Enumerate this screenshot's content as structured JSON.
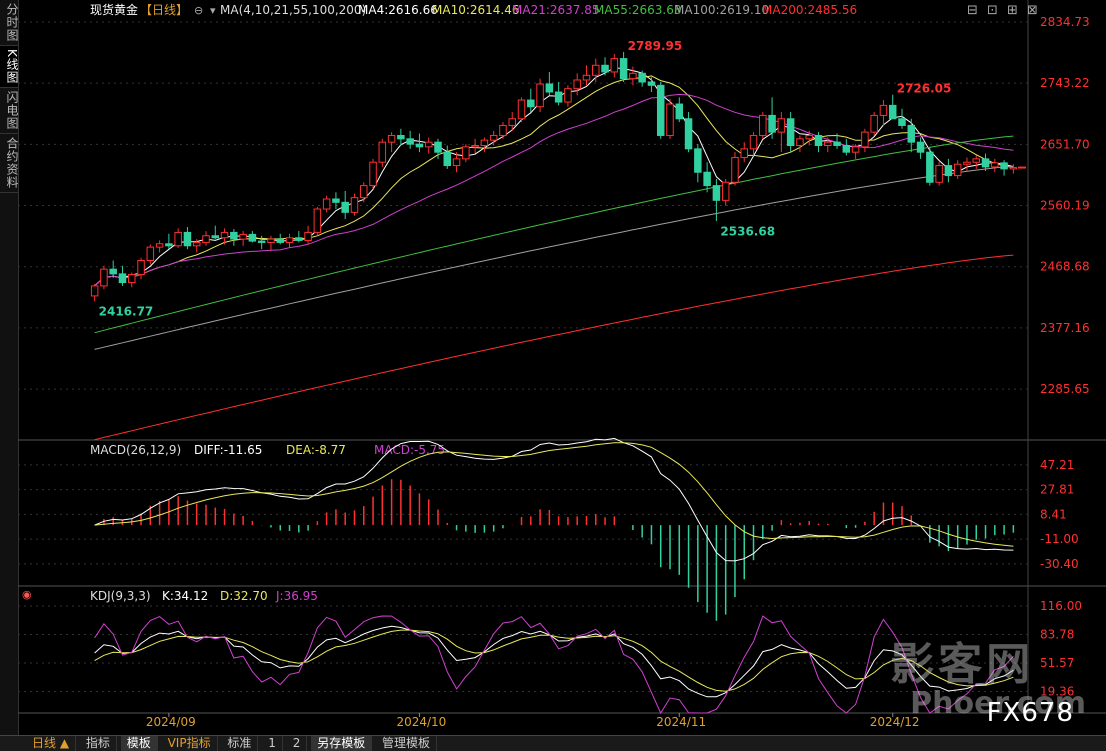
{
  "sidebar": {
    "tabs": [
      {
        "label": "分时图",
        "active": false
      },
      {
        "label": "K线图",
        "active": true
      },
      {
        "label": "闪电图",
        "active": false
      },
      {
        "label": "合约资料",
        "active": false
      }
    ]
  },
  "header": {
    "symbol": "现货黄金",
    "period_tag": "【日线】",
    "ma_label": "MA(4,10,21,55,100,200)",
    "ma_values": [
      {
        "text": "MA4:2616.66",
        "color": "#ffffff"
      },
      {
        "text": "MA10:2614.46",
        "color": "#e8e85a"
      },
      {
        "text": "MA21:2637.85",
        "color": "#d040d0"
      },
      {
        "text": "MA55:2663.63",
        "color": "#40c040"
      },
      {
        "text": "MA100:2619.10",
        "color": "#a0a0a0"
      },
      {
        "text": "MA200:2485.56",
        "color": "#ff3030"
      }
    ]
  },
  "toolbar_icons": [
    "minimize-icon",
    "restore-icon",
    "maximize-icon",
    "close-icon"
  ],
  "colors": {
    "up": "#ff3030",
    "down": "#30d0a0",
    "axis_text": "#ff3030",
    "grid": "#333333"
  },
  "chart_data": [
    {
      "type": "candlestick",
      "ylim": [
        2209.5,
        2834.73
      ],
      "yticks": [
        "2834.73",
        "2743.22",
        "2651.70",
        "2560.19",
        "2468.68",
        "2377.16",
        "2285.65"
      ],
      "xticks": [
        "2024/09",
        "2024/10",
        "2024/11",
        "2024/12"
      ],
      "annotations": [
        {
          "text": "2789.95",
          "candle": 57,
          "value": 2789.95,
          "kind": "high"
        },
        {
          "text": "2726.05",
          "candle": 86,
          "value": 2726.05,
          "kind": "high"
        },
        {
          "text": "2536.68",
          "candle": 67,
          "value": 2536.68,
          "kind": "low"
        },
        {
          "text": "2416.77",
          "candle": 0,
          "value": 2416.77,
          "kind": "low"
        }
      ],
      "ohlc": [
        [
          2425,
          2443,
          2417,
          2440
        ],
        [
          2440,
          2470,
          2435,
          2465
        ],
        [
          2465,
          2478,
          2452,
          2458
        ],
        [
          2458,
          2470,
          2440,
          2445
        ],
        [
          2445,
          2460,
          2438,
          2457
        ],
        [
          2457,
          2482,
          2450,
          2478
        ],
        [
          2478,
          2502,
          2472,
          2498
        ],
        [
          2498,
          2508,
          2490,
          2503
        ],
        [
          2503,
          2518,
          2495,
          2500
        ],
        [
          2500,
          2526,
          2497,
          2520
        ],
        [
          2520,
          2528,
          2495,
          2500
        ],
        [
          2500,
          2510,
          2490,
          2505
        ],
        [
          2505,
          2522,
          2500,
          2515
        ],
        [
          2515,
          2530,
          2510,
          2512
        ],
        [
          2512,
          2526,
          2502,
          2520
        ],
        [
          2520,
          2525,
          2500,
          2510
        ],
        [
          2510,
          2522,
          2500,
          2517
        ],
        [
          2517,
          2522,
          2505,
          2507
        ],
        [
          2507,
          2515,
          2495,
          2505
        ],
        [
          2505,
          2515,
          2492,
          2510
        ],
        [
          2510,
          2518,
          2502,
          2505
        ],
        [
          2505,
          2518,
          2498,
          2512
        ],
        [
          2512,
          2522,
          2505,
          2508
        ],
        [
          2508,
          2530,
          2502,
          2520
        ],
        [
          2520,
          2558,
          2515,
          2555
        ],
        [
          2555,
          2575,
          2550,
          2570
        ],
        [
          2570,
          2580,
          2555,
          2565
        ],
        [
          2565,
          2582,
          2540,
          2550
        ],
        [
          2550,
          2578,
          2545,
          2572
        ],
        [
          2572,
          2595,
          2565,
          2590
        ],
        [
          2590,
          2630,
          2585,
          2625
        ],
        [
          2625,
          2660,
          2618,
          2655
        ],
        [
          2655,
          2670,
          2640,
          2665
        ],
        [
          2665,
          2675,
          2650,
          2660
        ],
        [
          2660,
          2672,
          2645,
          2652
        ],
        [
          2652,
          2668,
          2640,
          2648
        ],
        [
          2648,
          2662,
          2638,
          2655
        ],
        [
          2655,
          2660,
          2630,
          2640
        ],
        [
          2640,
          2650,
          2615,
          2620
        ],
        [
          2620,
          2640,
          2610,
          2630
        ],
        [
          2630,
          2652,
          2625,
          2648
        ],
        [
          2648,
          2660,
          2638,
          2650
        ],
        [
          2650,
          2662,
          2640,
          2658
        ],
        [
          2658,
          2672,
          2650,
          2665
        ],
        [
          2665,
          2685,
          2660,
          2680
        ],
        [
          2680,
          2700,
          2672,
          2690
        ],
        [
          2690,
          2722,
          2685,
          2718
        ],
        [
          2718,
          2735,
          2700,
          2708
        ],
        [
          2708,
          2750,
          2700,
          2742
        ],
        [
          2742,
          2760,
          2725,
          2730
        ],
        [
          2730,
          2745,
          2710,
          2715
        ],
        [
          2715,
          2740,
          2708,
          2735
        ],
        [
          2735,
          2758,
          2725,
          2748
        ],
        [
          2748,
          2770,
          2740,
          2755
        ],
        [
          2755,
          2780,
          2745,
          2770
        ],
        [
          2770,
          2782,
          2755,
          2760
        ],
        [
          2760,
          2787,
          2752,
          2780
        ],
        [
          2780,
          2790,
          2745,
          2750
        ],
        [
          2750,
          2768,
          2740,
          2758
        ],
        [
          2758,
          2762,
          2738,
          2745
        ],
        [
          2745,
          2752,
          2730,
          2740
        ],
        [
          2740,
          2745,
          2660,
          2665
        ],
        [
          2665,
          2720,
          2660,
          2712
        ],
        [
          2712,
          2722,
          2685,
          2690
        ],
        [
          2690,
          2700,
          2640,
          2645
        ],
        [
          2645,
          2652,
          2595,
          2610
        ],
        [
          2610,
          2625,
          2580,
          2590
        ],
        [
          2590,
          2600,
          2537,
          2568
        ],
        [
          2568,
          2600,
          2560,
          2595
        ],
        [
          2595,
          2640,
          2590,
          2632
        ],
        [
          2632,
          2655,
          2625,
          2645
        ],
        [
          2645,
          2670,
          2635,
          2665
        ],
        [
          2665,
          2700,
          2660,
          2695
        ],
        [
          2695,
          2722,
          2660,
          2670
        ],
        [
          2670,
          2700,
          2640,
          2690
        ],
        [
          2690,
          2700,
          2640,
          2650
        ],
        [
          2650,
          2665,
          2640,
          2660
        ],
        [
          2660,
          2672,
          2650,
          2665
        ],
        [
          2665,
          2670,
          2640,
          2650
        ],
        [
          2650,
          2662,
          2640,
          2655
        ],
        [
          2655,
          2668,
          2645,
          2650
        ],
        [
          2650,
          2660,
          2635,
          2640
        ],
        [
          2640,
          2652,
          2630,
          2648
        ],
        [
          2648,
          2675,
          2640,
          2670
        ],
        [
          2670,
          2700,
          2665,
          2695
        ],
        [
          2695,
          2718,
          2680,
          2710
        ],
        [
          2710,
          2726,
          2700,
          2690
        ],
        [
          2690,
          2705,
          2675,
          2680
        ],
        [
          2680,
          2690,
          2640,
          2655
        ],
        [
          2655,
          2662,
          2630,
          2640
        ],
        [
          2640,
          2648,
          2590,
          2595
        ],
        [
          2595,
          2625,
          2590,
          2620
        ],
        [
          2620,
          2630,
          2595,
          2605
        ],
        [
          2605,
          2628,
          2600,
          2622
        ],
        [
          2622,
          2632,
          2612,
          2625
        ],
        [
          2625,
          2635,
          2615,
          2630
        ],
        [
          2630,
          2638,
          2612,
          2618
        ],
        [
          2618,
          2630,
          2610,
          2624
        ],
        [
          2624,
          2628,
          2605,
          2615
        ],
        [
          2615,
          2622,
          2608,
          2617
        ]
      ],
      "ma_series": [
        {
          "period": 4,
          "color": "#ffffff"
        },
        {
          "period": 10,
          "color": "#e8e85a"
        },
        {
          "period": 21,
          "color": "#d040d0"
        },
        {
          "period": 55,
          "color": "#40c040",
          "start": 2370,
          "end": 2664
        },
        {
          "period": 100,
          "color": "#a0a0a0",
          "start": 2345,
          "end": 2619
        },
        {
          "period": 200,
          "color": "#ff3030",
          "start": 2210,
          "end": 2486
        }
      ],
      "last_value_marker": "2617"
    },
    {
      "type": "macd",
      "title": "MACD(26,12,9)",
      "values": [
        {
          "text": "DIFF:-11.65",
          "color": "#ffffff"
        },
        {
          "text": "DEA:-8.77",
          "color": "#e8e85a"
        },
        {
          "text": "MACD:-5.75",
          "color": "#d040d0"
        }
      ],
      "ylim": [
        -47,
        55
      ],
      "yticks": [
        "47.21",
        "27.81",
        "8.41",
        "-11.00",
        "-30.40"
      ]
    },
    {
      "type": "kdj",
      "title": "KDJ(9,3,3)",
      "values": [
        {
          "text": "K:34.12",
          "color": "#ffffff"
        },
        {
          "text": "D:32.70",
          "color": "#e8e85a"
        },
        {
          "text": "J:36.95",
          "color": "#d040d0"
        }
      ],
      "ylim": [
        -5,
        125
      ],
      "yticks": [
        "116.00",
        "83.78",
        "51.57",
        "19.36"
      ]
    }
  ],
  "bottom": {
    "period_label": "日线",
    "tabs": [
      "指标",
      "模板",
      "VIP指标",
      "标准",
      "1",
      "2",
      "另存模板",
      "管理模板"
    ]
  },
  "watermark": {
    "main": "影客网",
    "sub": "Phoer.com",
    "brand": "FX678"
  }
}
